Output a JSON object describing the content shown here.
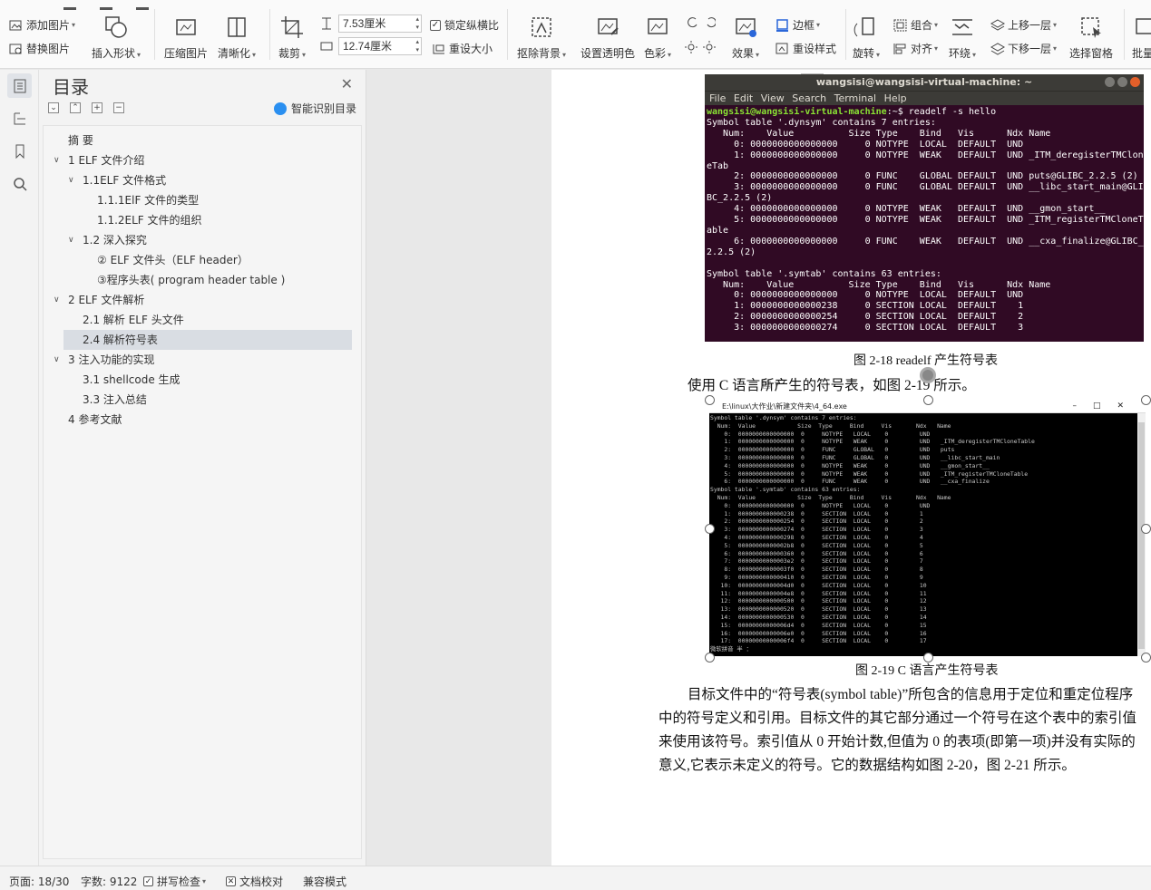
{
  "ribbon": {
    "add_picture": "添加图片",
    "replace_picture": "替换图片",
    "insert_shape": "插入形状",
    "compress_picture": "压缩图片",
    "clarify": "清晰化",
    "crop": "裁剪",
    "height_value": "7.53厘米",
    "width_value": "12.74厘米",
    "lock_ratio": "锁定纵横比",
    "reset_size": "重设大小",
    "remove_background": "抠除背景",
    "set_transparent": "设置透明色",
    "color": "色彩",
    "effects": "效果",
    "border": "边框",
    "reset_style": "重设样式",
    "rotate": "旋转",
    "group": "组合",
    "align": "对齐",
    "wrap": "环绕",
    "bring_forward": "上移一层",
    "send_backward": "下移一层",
    "selection_pane": "选择窗格",
    "batch": "批量"
  },
  "toc": {
    "title": "目录",
    "smart_toc": "智能识别目录",
    "items": [
      {
        "label": "摘  要"
      },
      {
        "label": "1 ELF 文件介绍"
      },
      {
        "label": "1.1ELF 文件格式"
      },
      {
        "label": "1.1.1ElF 文件的类型"
      },
      {
        "label": "1.1.2ELF 文件的组织"
      },
      {
        "label": "1.2 深入探究"
      },
      {
        "label": "② ELF 文件头（ELF header）"
      },
      {
        "label": "③程序头表( program header table )"
      },
      {
        "label": "2 ELF 文件解析"
      },
      {
        "label": "2.1 解析 ELF 头文件"
      },
      {
        "label": "2.4 解析符号表"
      },
      {
        "label": "3 注入功能的实现"
      },
      {
        "label": "3.1 shellcode 生成"
      },
      {
        "label": "3.3 注入总结"
      },
      {
        "label": "4 参考文献"
      }
    ]
  },
  "document": {
    "terminal1": {
      "title": "wangsisi@wangsisi-virtual-machine: ~",
      "menu": "File Edit View Search Terminal Help",
      "prompt": "wangsisi@wangsisi-virtual-machine",
      "command": ":~$ readelf -s hello",
      "output": "\nSymbol table '.dynsym' contains 7 entries:\n   Num:    Value          Size Type    Bind   Vis      Ndx Name\n     0: 0000000000000000     0 NOTYPE  LOCAL  DEFAULT  UND\n     1: 0000000000000000     0 NOTYPE  WEAK   DEFAULT  UND _ITM_deregisterTMClon\neTab\n     2: 0000000000000000     0 FUNC    GLOBAL DEFAULT  UND puts@GLIBC_2.2.5 (2)\n     3: 0000000000000000     0 FUNC    GLOBAL DEFAULT  UND __libc_start_main@GLI\nBC_2.2.5 (2)\n     4: 0000000000000000     0 NOTYPE  WEAK   DEFAULT  UND __gmon_start__\n     5: 0000000000000000     0 NOTYPE  WEAK   DEFAULT  UND _ITM_registerTMCloneT\nable\n     6: 0000000000000000     0 FUNC    WEAK   DEFAULT  UND __cxa_finalize@GLIBC_\n2.2.5 (2)\n\nSymbol table '.symtab' contains 63 entries:\n   Num:    Value          Size Type    Bind   Vis      Ndx Name\n     0: 0000000000000000     0 NOTYPE  LOCAL  DEFAULT  UND\n     1: 0000000000000238     0 SECTION LOCAL  DEFAULT    1\n     2: 0000000000000254     0 SECTION LOCAL  DEFAULT    2\n     3: 0000000000000274     0 SECTION LOCAL  DEFAULT    3"
    },
    "caption1": "图 2-18 readelf 产生符号表",
    "para1": "使用 C 语言所产生的符号表，如图 2-19 所示。",
    "terminal2": {
      "title": "E:\\linux\\大作业\\新建文件夹\\4_64.exe",
      "output": "Symbol table '.dynsym' contains 7 entries:\n  Num:  Value            Size  Type     Bind     Vis       Ndx   Name\n    0:  0000000000000000  0     NOTYPE   LOCAL    0         UND\n    1:  0000000000000000  0     NOTYPE   WEAK     0         UND   _ITM_deregisterTMCloneTable\n    2:  0000000000000000  0     FUNC     GLOBAL   0         UND   puts\n    3:  0000000000000000  0     FUNC     GLOBAL   0         UND   __libc_start_main\n    4:  0000000000000000  0     NOTYPE   WEAK     0         UND   __gmon_start__\n    5:  0000000000000000  0     NOTYPE   WEAK     0         UND   _ITM_registerTMCloneTable\n    6:  0000000000000000  0     FUNC     WEAK     0         UND   __cxa_finalize\nSymbol table '.symtab' contains 63 entries:\n  Num:  Value            Size  Type     Bind     Vis       Ndx   Name\n    0:  0000000000000000  0     NOTYPE   LOCAL    0         UND\n    1:  0000000000000238  0     SECTION  LOCAL    0         1\n    2:  0000000000000254  0     SECTION  LOCAL    0         2\n    3:  0000000000000274  0     SECTION  LOCAL    0         3\n    4:  0000000000000298  0     SECTION  LOCAL    0         4\n    5:  00000000000002b8  0     SECTION  LOCAL    0         5\n    6:  0000000000000360  0     SECTION  LOCAL    0         6\n    7:  00000000000003e2  0     SECTION  LOCAL    0         7\n    8:  00000000000003f0  0     SECTION  LOCAL    0         8\n    9:  0000000000000410  0     SECTION  LOCAL    0         9\n   10:  00000000000004d0  0     SECTION  LOCAL    0         10\n   11:  00000000000004e8  0     SECTION  LOCAL    0         11\n   12:  0000000000000500  0     SECTION  LOCAL    0         12\n   13:  0000000000000520  0     SECTION  LOCAL    0         13\n   14:  0000000000000530  0     SECTION  LOCAL    0         14\n   15:  00000000000006d4  0     SECTION  LOCAL    0         15\n   16:  00000000000006e0  0     SECTION  LOCAL    0         16\n   17:  00000000000006f4  0     SECTION  LOCAL    0         17",
      "ime": "微软拼音 半 ："
    },
    "caption2": "图 2-19 C 语言产生符号表",
    "para2_lines": [
      "目标文件中的“符号表(symbol table)”所包含的信息用于定位和重定位程序",
      "中的符号定义和引用。目标文件的其它部分通过一个符号在这个表中的索引值",
      "来使用该符号。索引值从 0 开始计数,但值为 0 的表项(即第一项)并没有实际的",
      "意义,它表示未定义的符号。它的数据结构如图 2-20，图 2-21 所示。"
    ]
  },
  "statusbar": {
    "page": "页面: 18/30",
    "wordcount": "字数: 9122",
    "spellcheck": "拼写检查",
    "proofread": "文档校对",
    "compat": "兼容模式"
  },
  "colors": {
    "ubuntu_terminal_bg": "#300a24",
    "prompt_green": "#8ae234",
    "toc_selected": "#d9dde3",
    "smart_toc_blue": "#2a8ff0"
  }
}
